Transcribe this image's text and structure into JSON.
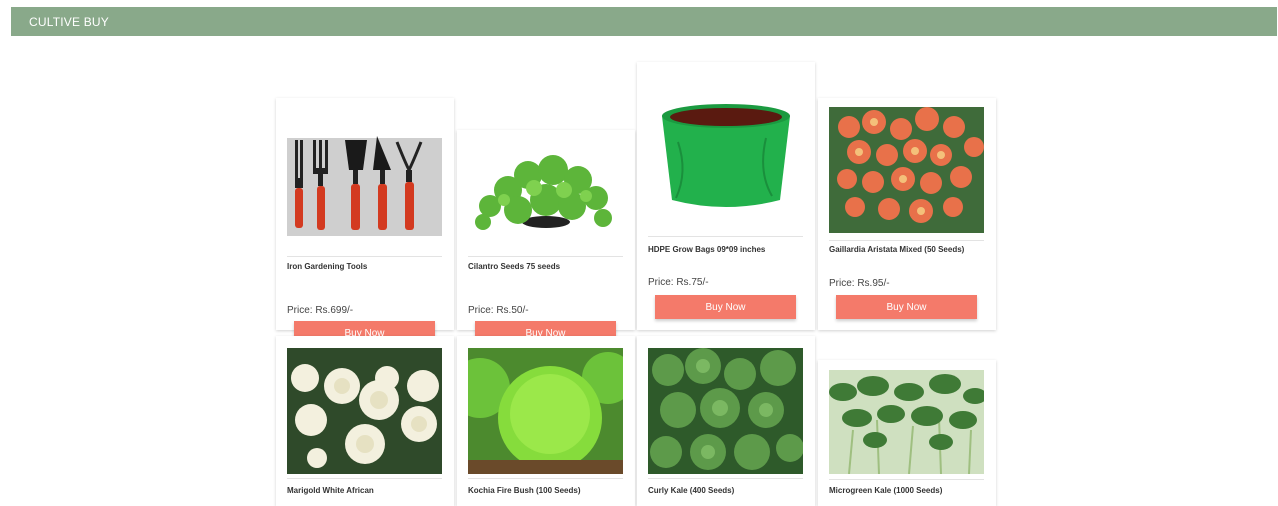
{
  "header": {
    "brand": "CULTIVE BUY"
  },
  "colors": {
    "header_bg": "#89a98a",
    "button_bg": "#f47a6a",
    "button_text": "#ffffff"
  },
  "products": [
    {
      "name": "Iron Gardening Tools",
      "price": "Price: Rs.699/-",
      "button": "Buy Now",
      "image_icon": "gardening-tools-image"
    },
    {
      "name": "Cilantro Seeds 75 seeds",
      "price": "Price: Rs.50/-",
      "button": "Buy Now",
      "image_icon": "cilantro-plant-image"
    },
    {
      "name": "HDPE Grow Bags 09*09 inches",
      "price": "Price: Rs.75/-",
      "button": "Buy Now",
      "image_icon": "grow-bag-image"
    },
    {
      "name": "Gaillardia Aristata Mixed (50 Seeds)",
      "price": "Price: Rs.95/-",
      "button": "Buy Now",
      "image_icon": "gaillardia-flowers-image"
    },
    {
      "name": "Marigold White African",
      "image_icon": "white-marigold-image"
    },
    {
      "name": "Kochia Fire Bush (100 Seeds)",
      "image_icon": "kochia-bush-image"
    },
    {
      "name": "Curly Kale (400 Seeds)",
      "image_icon": "curly-kale-image"
    },
    {
      "name": "Microgreen Kale (1000 Seeds)",
      "image_icon": "microgreen-kale-image"
    }
  ]
}
